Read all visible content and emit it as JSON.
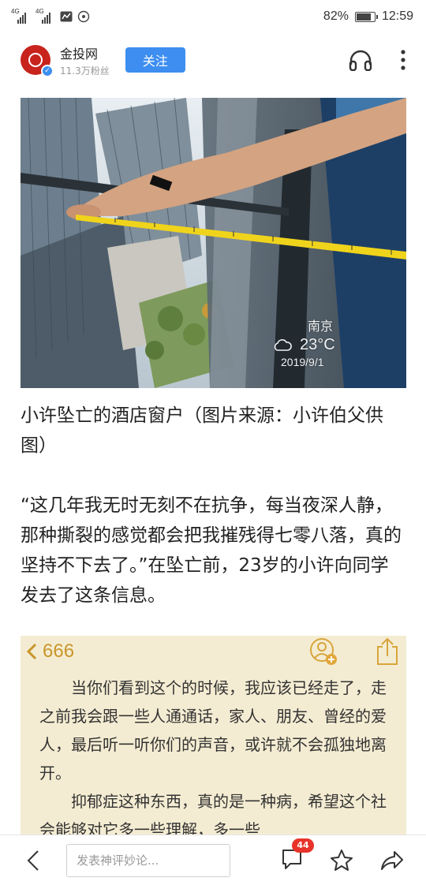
{
  "status_bar": {
    "network_1": "4G",
    "network_2": "4G",
    "battery": "82%",
    "battery_level": 0.82,
    "time": "12:59"
  },
  "header": {
    "account_name": "金投网",
    "fans": "11.3万粉丝",
    "follow_label": "关注"
  },
  "article": {
    "photo1": {
      "watermark_city": "南京",
      "watermark_temp": "23°C",
      "watermark_date": "2019/9/1"
    },
    "caption": "小许坠亡的酒店窗户（图片来源：小许伯父供图）",
    "paragraph": "“这几年我无时无刻不在抗争，每当夜深人静，那种撕裂的感觉都会把我摧残得七零八落，真的坚持不下去了。”在坠亡前，23岁的小许向同学发去了这条信息。",
    "photo2": {
      "back_label": "666",
      "note_p1": "当你们看到这个的时候，我应该已经走了，走之前我会跟一些人通通话，家人、朋友、曾经的爱人，最后听一听你们的声音，或许就不会孤独地离开。",
      "note_p2": "抑郁症这种东西，真的是一种病，希望这个社会能够对它多一些理解，多一些"
    }
  },
  "bottom_bar": {
    "comment_placeholder": "发表神评妙论...",
    "comment_count": "44"
  },
  "colors": {
    "accent": "#3d8ef0",
    "badge": "#e8332a",
    "logo": "#c8231d"
  }
}
